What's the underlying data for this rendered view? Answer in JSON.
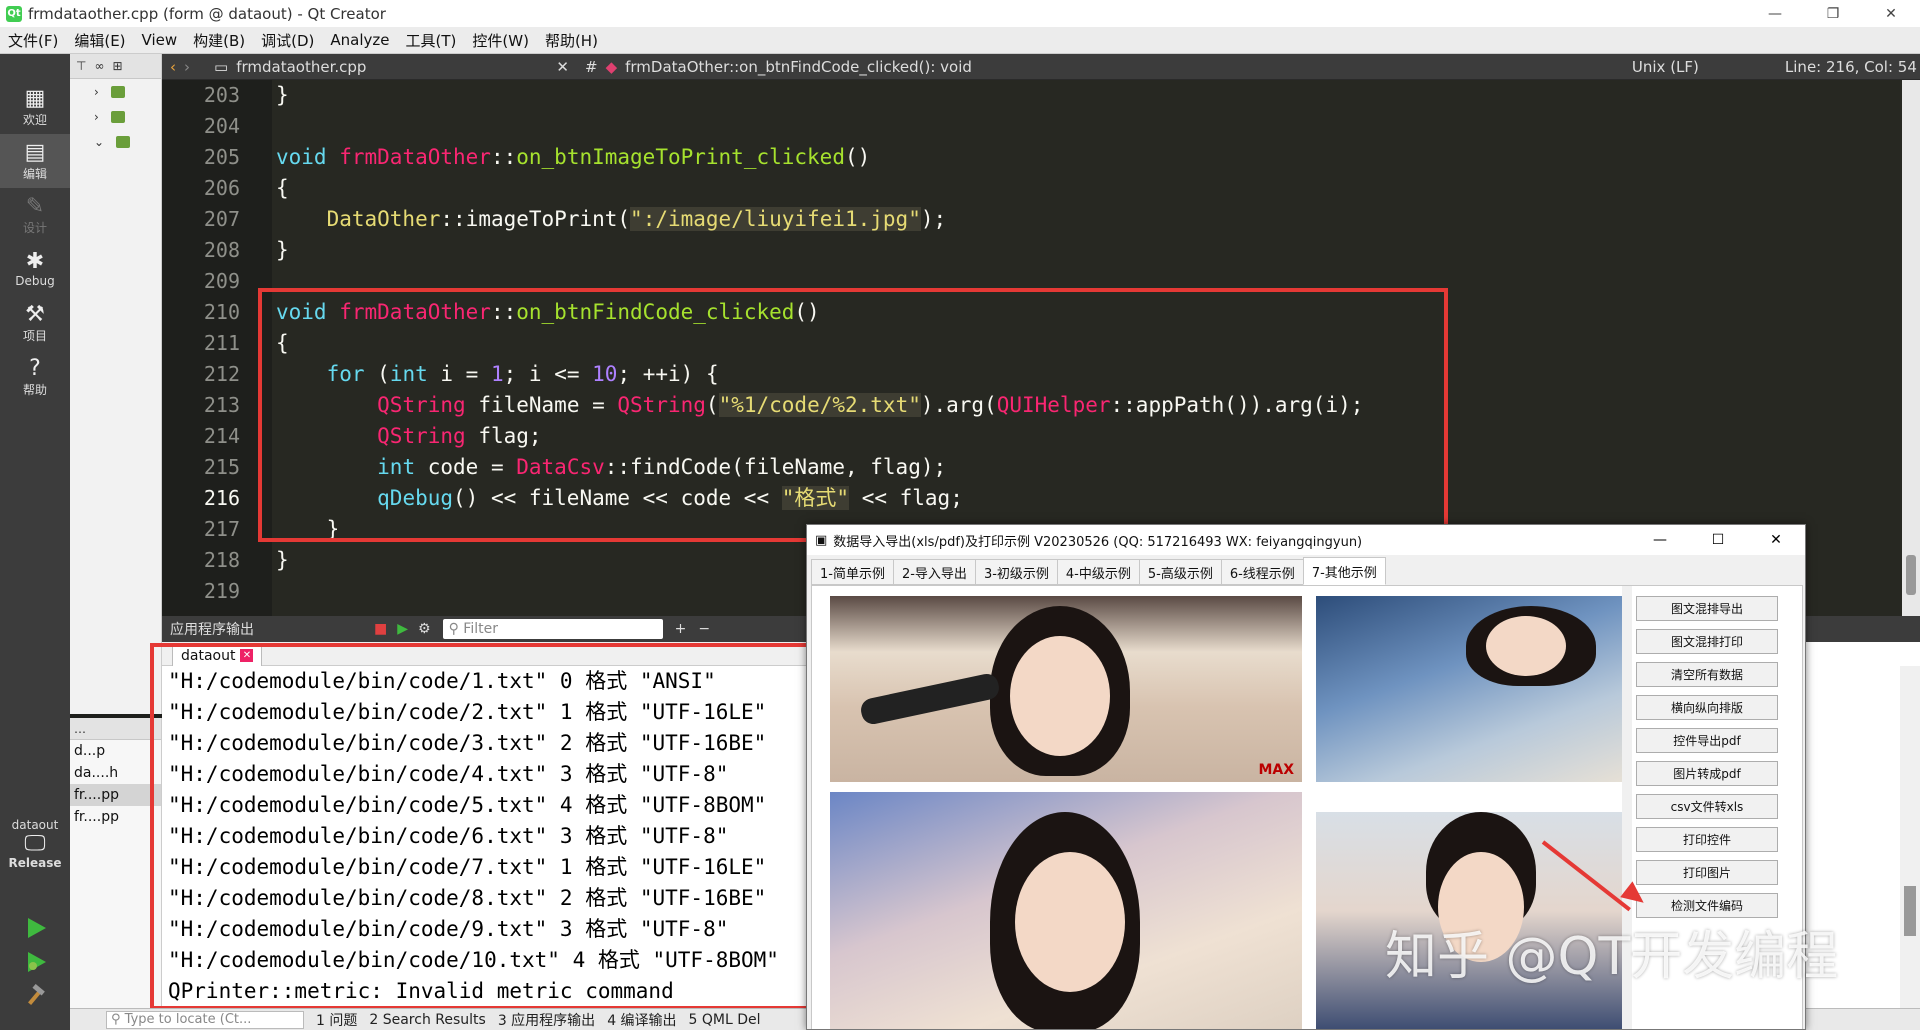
{
  "window": {
    "title": "frmdataother.cpp (form @ dataout) - Qt Creator",
    "minimize": "—",
    "restore": "❐",
    "close": "✕"
  },
  "menu": [
    "文件(F)",
    "编辑(E)",
    "View",
    "构建(B)",
    "调试(D)",
    "Analyze",
    "工具(T)",
    "控件(W)",
    "帮助(H)"
  ],
  "modes": [
    {
      "label": "欢迎",
      "icon": "grid-icon"
    },
    {
      "label": "编辑",
      "icon": "edit-icon"
    },
    {
      "label": "设计",
      "icon": "pencil-icon"
    },
    {
      "label": "Debug",
      "icon": "bug-icon"
    },
    {
      "label": "项目",
      "icon": "wrench-icon"
    },
    {
      "label": "帮助",
      "icon": "help-icon"
    }
  ],
  "target": {
    "project": "dataout",
    "config": "Release"
  },
  "editor_toolbar": {
    "file": "frmdataother.cpp",
    "hash": "#",
    "function": "frmDataOther::on_btnFindCode_clicked(): void",
    "line_ending": "Unix (LF)",
    "position": "Line: 216, Col: 54"
  },
  "line_numbers": [
    "203",
    "204",
    "205",
    "206",
    "207",
    "208",
    "209",
    "210",
    "211",
    "212",
    "213",
    "214",
    "215",
    "216",
    "217",
    "218",
    "219"
  ],
  "open_docs": [
    "d...p",
    "da....h",
    "fr....pp",
    "fr....pp"
  ],
  "output_toolbar": {
    "title": "应用程序输出",
    "filter_placeholder": "Filter"
  },
  "output_tab": "dataout",
  "output_lines": [
    "\"H:/codemodule/bin/code/1.txt\" 0 格式 \"ANSI\"",
    "\"H:/codemodule/bin/code/2.txt\" 1 格式 \"UTF-16LE\"",
    "\"H:/codemodule/bin/code/3.txt\" 2 格式 \"UTF-16BE\"",
    "\"H:/codemodule/bin/code/4.txt\" 3 格式 \"UTF-8\"",
    "\"H:/codemodule/bin/code/5.txt\" 4 格式 \"UTF-8BOM\"",
    "\"H:/codemodule/bin/code/6.txt\" 3 格式 \"UTF-8\"",
    "\"H:/codemodule/bin/code/7.txt\" 1 格式 \"UTF-16LE\"",
    "\"H:/codemodule/bin/code/8.txt\" 2 格式 \"UTF-16BE\"",
    "\"H:/codemodule/bin/code/9.txt\" 3 格式 \"UTF-8\"",
    "\"H:/codemodule/bin/code/10.txt\" 4 格式 \"UTF-8BOM\"",
    "QPrinter::metric: Invalid metric command"
  ],
  "statusbar": {
    "locate_placeholder": "Type to locate (Ct...",
    "panes": [
      "1 问题",
      "2 Search Results",
      "3 应用程序输出",
      "4 编译输出",
      "5 QML Del"
    ]
  },
  "demo_window": {
    "title": "数据导入导出(xls/pdf)及打印示例 V20230526 (QQ: 517216493 WX: feiyangqingyun)",
    "tabs": [
      "1-简单示例",
      "2-导入导出",
      "3-初级示例",
      "4-中级示例",
      "5-高级示例",
      "6-线程示例",
      "7-其他示例"
    ],
    "active_tab": 6,
    "buttons": [
      "图文混排导出",
      "图文混排打印",
      "清空所有数据",
      "横向纵向排版",
      "控件导出pdf",
      "图片转成pdf",
      "csv文件转xls",
      "打印控件",
      "打印图片",
      "检测文件编码"
    ],
    "photo_mark": "MAX"
  },
  "watermark": "知乎 @QT开发编程",
  "colors": {
    "highlight": "#e53935",
    "editor_bg": "#272822"
  }
}
